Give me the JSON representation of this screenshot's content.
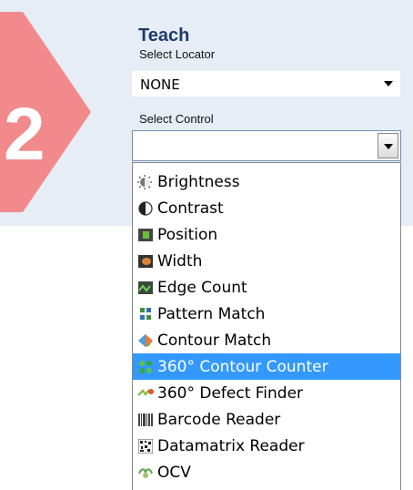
{
  "header": {
    "title": "Teach",
    "step_number": "2",
    "badge_color": "#f2898c"
  },
  "locator": {
    "label": "Select Locator",
    "value": "NONE"
  },
  "control": {
    "label": "Select Control",
    "value": "",
    "options": [
      {
        "label": "Brightness",
        "icon": "brightness-icon",
        "selected": false
      },
      {
        "label": "Contrast",
        "icon": "contrast-icon",
        "selected": false
      },
      {
        "label": "Position",
        "icon": "position-icon",
        "selected": false
      },
      {
        "label": "Width",
        "icon": "width-icon",
        "selected": false
      },
      {
        "label": "Edge Count",
        "icon": "edge-count-icon",
        "selected": false
      },
      {
        "label": "Pattern Match",
        "icon": "pattern-match-icon",
        "selected": false
      },
      {
        "label": "Contour Match",
        "icon": "contour-match-icon",
        "selected": false
      },
      {
        "label": "360° Contour Counter",
        "icon": "contour-counter-icon",
        "selected": true
      },
      {
        "label": "360° Defect Finder",
        "icon": "defect-finder-icon",
        "selected": false
      },
      {
        "label": "Barcode Reader",
        "icon": "barcode-icon",
        "selected": false
      },
      {
        "label": "Datamatrix Reader",
        "icon": "datamatrix-icon",
        "selected": false
      },
      {
        "label": "OCV",
        "icon": "ocv-icon",
        "selected": false
      }
    ]
  },
  "colors": {
    "panel_bg": "#e6edf4",
    "selection": "#3399ff",
    "title": "#1c3a6d"
  }
}
